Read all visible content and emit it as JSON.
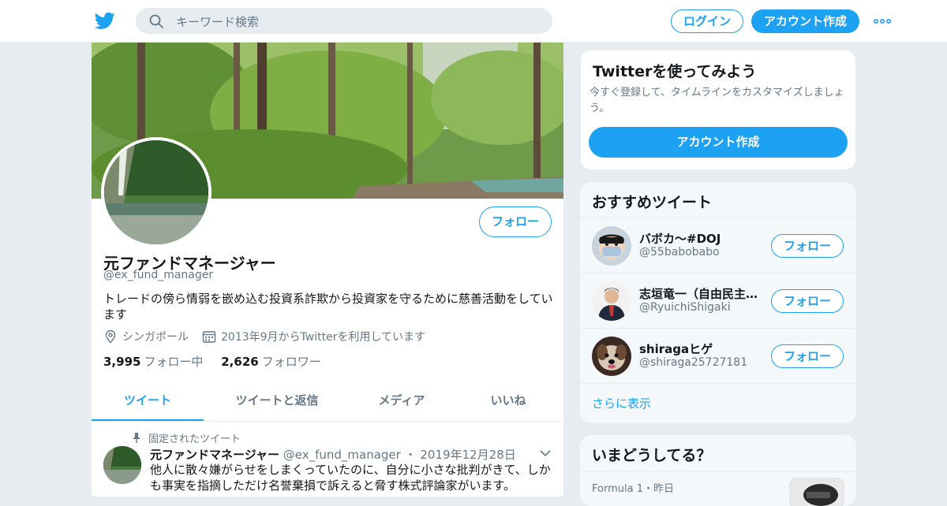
{
  "header": {
    "search_placeholder": "キーワード検索",
    "login_label": "ログイン",
    "signup_label": "アカウント作成"
  },
  "profile": {
    "follow_label": "フォロー",
    "name": "元ファンドマネージャー",
    "handle": "@ex_fund_manager",
    "bio": "トレードの傍ら情弱を嵌め込む投資系詐欺から投資家を守るために慈善活動をしています",
    "location": "シンガポール",
    "joined": "2013年9月からTwitterを利用しています",
    "following_count": "3,995",
    "following_label": "フォロー中",
    "followers_count": "2,626",
    "followers_label": "フォロワー",
    "tabs": [
      "ツイート",
      "ツイートと返信",
      "メディア",
      "いいね"
    ]
  },
  "pinned_tweet": {
    "pinned_label": "固定されたツイート",
    "name": "元ファンドマネージャー",
    "handle": "@ex_fund_manager",
    "date": "2019年12月28日",
    "text": "他人に散々嫌がらせをしまくっていたのに、自分に小さな批判がきて、しかも事実を指摘しただけ名誉棄損で訴えると脅す株式評論家がいます。"
  },
  "try_card": {
    "title": "Twitterを使ってみよう",
    "description": "今すぐ登録して、タイムラインをカスタマイズしましょう。",
    "button_label": "アカウント作成"
  },
  "recommended": {
    "title": "おすすめツイート",
    "items": [
      {
        "name": "バボカ～#DOJ",
        "handle": "@55babobabo",
        "follow_label": "フォロー"
      },
      {
        "name": "志垣竜一（自由民主党）",
        "handle": "@RyuichiShigaki",
        "follow_label": "フォロー"
      },
      {
        "name": "shiragaヒゲ",
        "handle": "@shiraga25727181",
        "follow_label": "フォロー"
      }
    ],
    "more_label": "さらに表示"
  },
  "trending": {
    "title": "いまどうしてる？",
    "meta": "Formula 1・昨日"
  },
  "colors": {
    "accent": "#1da1f2",
    "text_secondary": "#657786",
    "background": "#e6ecf0"
  }
}
